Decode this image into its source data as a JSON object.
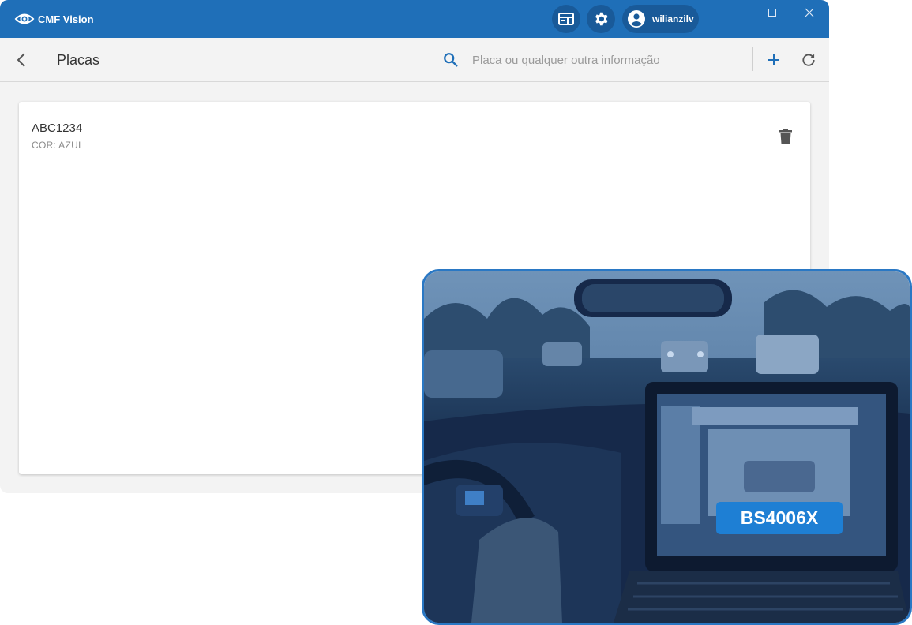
{
  "app": {
    "brand": "CMF Vision"
  },
  "header": {
    "user_name": "wilianzilv",
    "brand_color": "#1f6fb8"
  },
  "toolbar": {
    "title": "Placas",
    "search_placeholder": "Placa ou qualquer outra informação"
  },
  "plates": [
    {
      "number": "ABC1234",
      "detail": "COR: AZUL"
    }
  ],
  "promo": {
    "detected_plate": "BS4006X"
  },
  "icons": [
    "eye-logo-icon",
    "dashboard-icon",
    "gear-icon",
    "account-circle-icon",
    "minimize-icon",
    "maximize-icon",
    "close-icon",
    "back-arrow-icon",
    "search-icon",
    "add-icon",
    "refresh-icon",
    "trash-icon"
  ]
}
